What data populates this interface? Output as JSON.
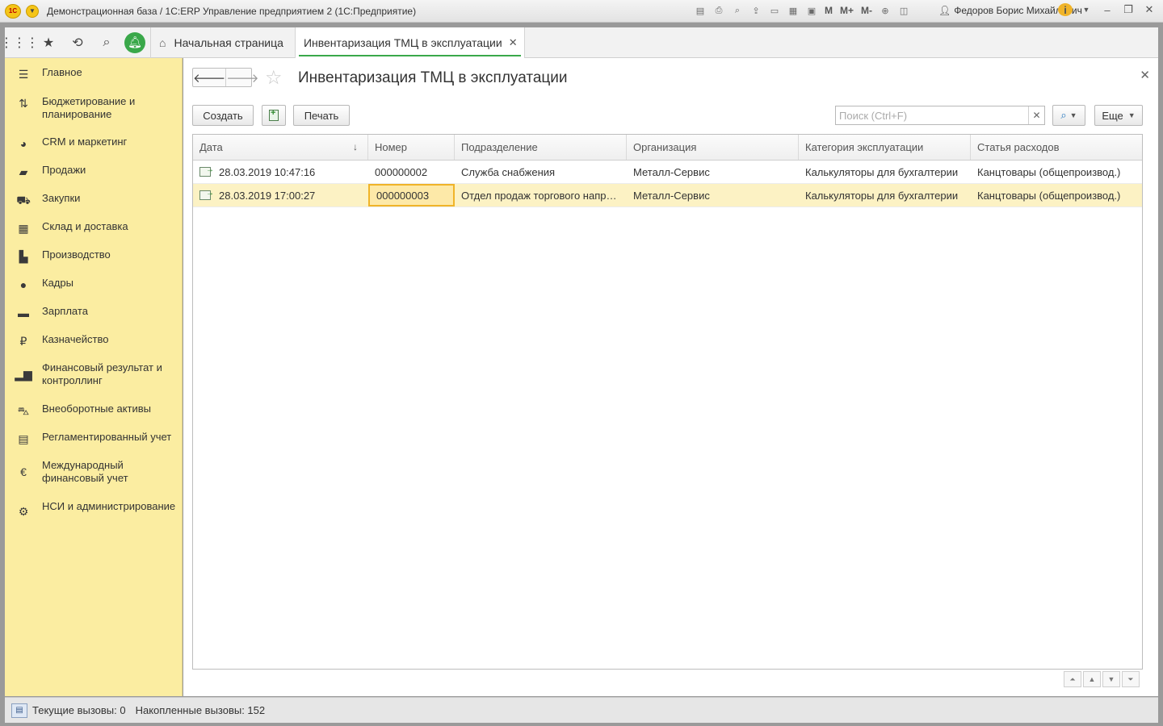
{
  "titlebar": {
    "logo": "1С",
    "title": "Демонстрационная база / 1С:ERP Управление предприятием 2  (1С:Предприятие)",
    "tools": [
      "save-icon",
      "print-icon",
      "preview-icon",
      "upload-icon",
      "scan-icon",
      "calculator-icon",
      "calendar-icon",
      "M",
      "M+",
      "M-",
      "zoom-icon",
      "panels-icon"
    ],
    "mem_labels": {
      "m": "M",
      "mplus": "M+",
      "mminus": "M-"
    },
    "user": "Федоров Борис Михайлович"
  },
  "tabstrip": {
    "home_label": "Начальная страница",
    "active_tab_label": "Инвентаризация ТМЦ в эксплуатации"
  },
  "sidebar": {
    "items": [
      {
        "label": "Главное",
        "icon": "menu-lines-icon"
      },
      {
        "label": "Бюджетирование и планирование",
        "icon": "budget-icon"
      },
      {
        "label": "CRM и маркетинг",
        "icon": "pie-chart-icon"
      },
      {
        "label": "Продажи",
        "icon": "briefcase-icon"
      },
      {
        "label": "Закупки",
        "icon": "cart-icon"
      },
      {
        "label": "Склад и доставка",
        "icon": "warehouse-icon"
      },
      {
        "label": "Производство",
        "icon": "factory-icon"
      },
      {
        "label": "Кадры",
        "icon": "person-icon"
      },
      {
        "label": "Зарплата",
        "icon": "salary-icon"
      },
      {
        "label": "Казначейство",
        "icon": "ruble-icon"
      },
      {
        "label": "Финансовый результат и контроллинг",
        "icon": "bar-chart-icon"
      },
      {
        "label": "Внеоборотные активы",
        "icon": "truck-icon"
      },
      {
        "label": "Регламентированный учет",
        "icon": "calculator-icon"
      },
      {
        "label": "Международный финансовый учет",
        "icon": "euro-icon"
      },
      {
        "label": "НСИ и администрирование",
        "icon": "gear-icon"
      }
    ]
  },
  "form": {
    "title": "Инвентаризация ТМЦ в эксплуатации",
    "create_label": "Создать",
    "print_label": "Печать",
    "search_placeholder": "Поиск (Ctrl+F)",
    "more_label": "Еще"
  },
  "table": {
    "columns": [
      "Дата",
      "Номер",
      "Подразделение",
      "Организация",
      "Категория эксплуатации",
      "Статья расходов"
    ],
    "sort_column": "Дата",
    "sort_direction": "descending",
    "rows": [
      [
        "28.03.2019 10:47:16",
        "000000002",
        "Служба снабжения",
        "Металл-Сервис",
        "Калькуляторы для бухгалтерии",
        "Канцтовары (общепроизвод.)"
      ],
      [
        "28.03.2019 17:00:27",
        "000000003",
        "Отдел продаж торгового напр…",
        "Металл-Сервис",
        "Калькуляторы для бухгалтерии",
        "Канцтовары (общепроизвод.)"
      ]
    ],
    "selected_row": 1
  },
  "status": {
    "current_calls": "Текущие вызовы: 0",
    "accumulated_calls": "Накопленные вызовы: 152"
  },
  "colors": {
    "sidebar": "#fbeda1",
    "selected_row": "#fcf2c4",
    "focus_cell": "#f0b429",
    "accent_green": "#3aa84a"
  }
}
